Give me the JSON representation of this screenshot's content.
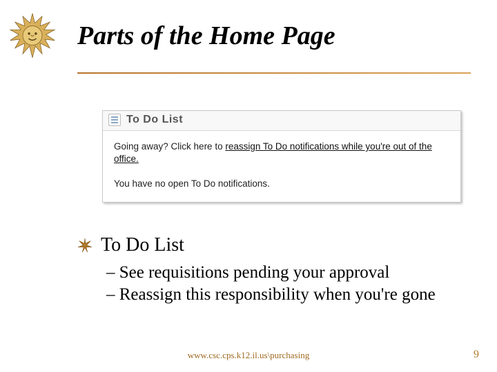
{
  "slide": {
    "title": "Parts of the Home Page",
    "panel": {
      "title": "To Do List",
      "going_away_prefix": "Going away? Click here to ",
      "reassign_link": "reassign To Do notifications while you're out of the office.",
      "no_open_msg": "You have no open To Do notifications."
    },
    "bullet_main": "To Do List",
    "sub_bullets": [
      "– See requisitions pending your approval",
      "– Reassign this responsibility when you're gone"
    ],
    "footer_url": "www.csc.cps.k12.il.us\\purchasing",
    "slide_number": "9"
  }
}
